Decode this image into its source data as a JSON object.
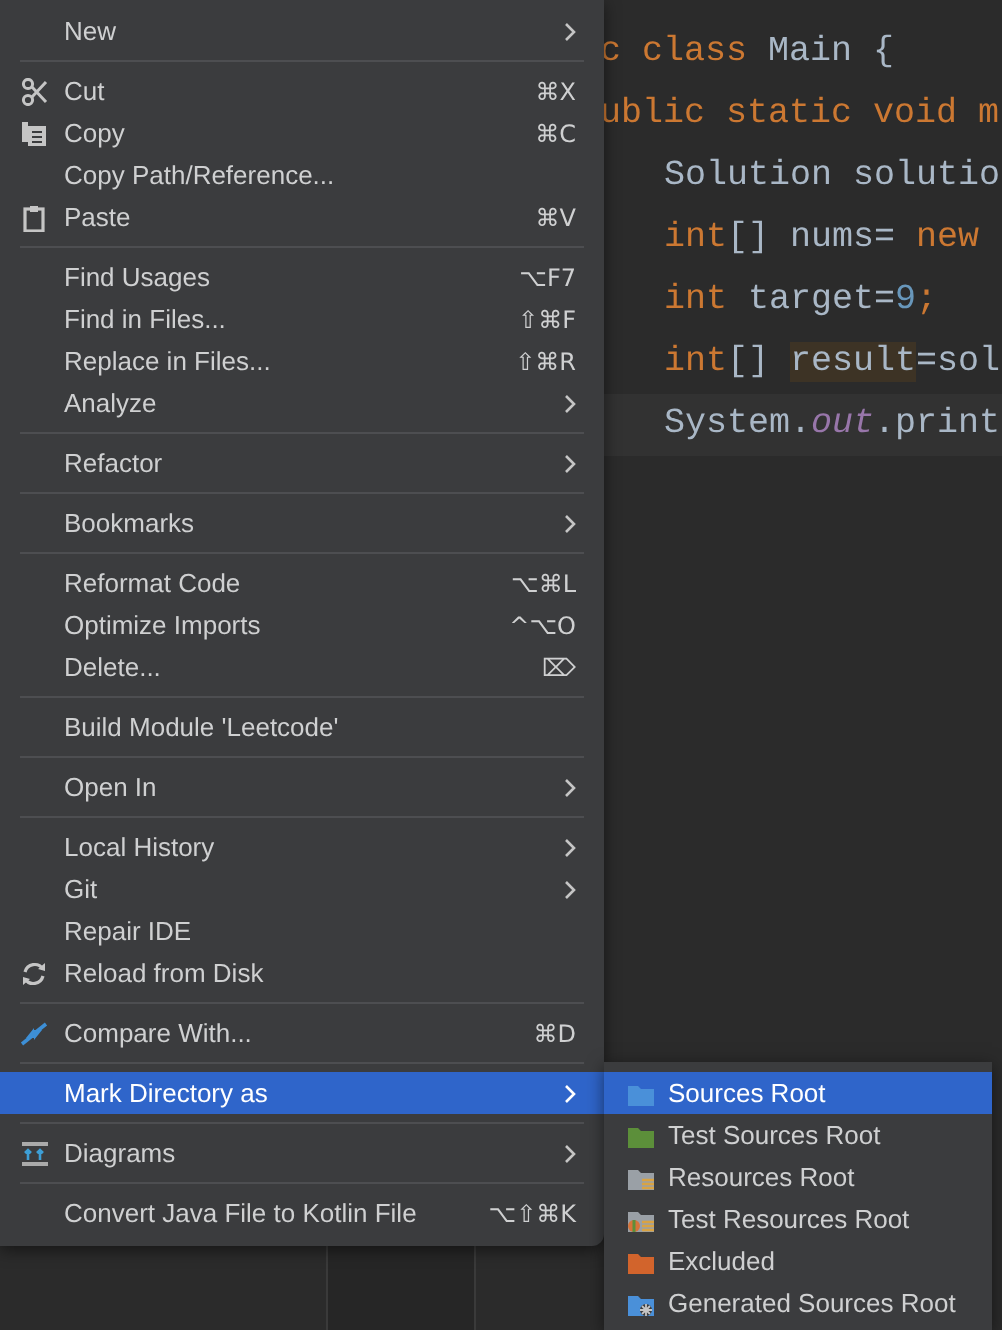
{
  "editor": {
    "lines": [
      {
        "kind": "signature",
        "tokens": [
          {
            "kind": "keyword",
            "text": "c class "
          },
          {
            "kind": "plain",
            "text": "Main {"
          }
        ]
      },
      {
        "kind": "signature",
        "tokens": [
          {
            "kind": "keyword",
            "text": "ublic static void m"
          }
        ]
      },
      {
        "kind": "body",
        "tokens": [
          {
            "kind": "plain",
            "text": "Solution solutio"
          }
        ]
      },
      {
        "kind": "body",
        "tokens": [
          {
            "kind": "keyword",
            "text": "int"
          },
          {
            "kind": "plain",
            "text": "[] nums= "
          },
          {
            "kind": "keyword",
            "text": "new"
          }
        ]
      },
      {
        "kind": "body",
        "tokens": [
          {
            "kind": "keyword",
            "text": "int "
          },
          {
            "kind": "plain",
            "text": "target="
          },
          {
            "kind": "number",
            "text": "9"
          },
          {
            "kind": "keyword",
            "text": ";"
          }
        ]
      },
      {
        "kind": "body",
        "tokens": [
          {
            "kind": "keyword",
            "text": "int"
          },
          {
            "kind": "plain",
            "text": "[] "
          },
          {
            "kind": "highlighted",
            "text": "result"
          },
          {
            "kind": "plain",
            "text": "=sol"
          }
        ]
      },
      {
        "kind": "current",
        "tokens": [
          {
            "kind": "plain",
            "text": "System."
          },
          {
            "kind": "field",
            "text": "out"
          },
          {
            "kind": "plain",
            "text": ".print"
          }
        ]
      }
    ]
  },
  "context_menu": {
    "groups": [
      [
        {
          "label": "New",
          "submenu": true,
          "selected": false
        }
      ],
      [
        {
          "label": "Cut",
          "shortcut": "⌘X",
          "kind": "scissors",
          "submenu": false,
          "selected": false
        },
        {
          "label": "Copy",
          "shortcut": "⌘C",
          "kind": "copy",
          "submenu": false,
          "selected": false
        },
        {
          "label": "Copy Path/Reference...",
          "submenu": false,
          "selected": false
        },
        {
          "label": "Paste",
          "shortcut": "⌘V",
          "kind": "paste",
          "submenu": false,
          "selected": false
        }
      ],
      [
        {
          "label": "Find Usages",
          "shortcut": "⌥F7",
          "submenu": false,
          "selected": false
        },
        {
          "label": "Find in Files...",
          "shortcut": "⇧⌘F",
          "submenu": false,
          "selected": false
        },
        {
          "label": "Replace in Files...",
          "shortcut": "⇧⌘R",
          "submenu": false,
          "selected": false
        },
        {
          "label": "Analyze",
          "submenu": true,
          "selected": false
        }
      ],
      [
        {
          "label": "Refactor",
          "submenu": true,
          "selected": false
        }
      ],
      [
        {
          "label": "Bookmarks",
          "submenu": true,
          "selected": false
        }
      ],
      [
        {
          "label": "Reformat Code",
          "shortcut": "⌥⌘L",
          "submenu": false,
          "selected": false
        },
        {
          "label": "Optimize Imports",
          "shortcut": "^⌥O",
          "submenu": false,
          "selected": false
        },
        {
          "label": "Delete...",
          "shortcut": "⌦",
          "submenu": false,
          "selected": false
        }
      ],
      [
        {
          "label": "Build Module 'Leetcode'",
          "submenu": false,
          "selected": false
        }
      ],
      [
        {
          "label": "Open In",
          "submenu": true,
          "selected": false
        }
      ],
      [
        {
          "label": "Local History",
          "submenu": true,
          "selected": false
        },
        {
          "label": "Git",
          "submenu": true,
          "selected": false
        },
        {
          "label": "Repair IDE",
          "submenu": false,
          "selected": false
        },
        {
          "label": "Reload from Disk",
          "kind": "reload",
          "submenu": false,
          "selected": false
        }
      ],
      [
        {
          "label": "Compare With...",
          "shortcut": "⌘D",
          "kind": "compare",
          "submenu": false,
          "selected": false
        }
      ],
      [
        {
          "label": "Mark Directory as",
          "submenu": true,
          "selected": true
        }
      ],
      [
        {
          "label": "Diagrams",
          "kind": "diagram",
          "submenu": true,
          "selected": false
        }
      ],
      [
        {
          "label": "Convert Java File to Kotlin File",
          "shortcut": "⌥⇧⌘K",
          "submenu": false,
          "selected": false
        }
      ]
    ]
  },
  "submenu": {
    "items": [
      {
        "label": "Sources Root",
        "kind": "sources",
        "selected": true
      },
      {
        "label": "Test Sources Root",
        "kind": "test_sources",
        "selected": false
      },
      {
        "label": "Resources Root",
        "kind": "resources",
        "selected": false
      },
      {
        "label": "Test Resources Root",
        "kind": "test_resources",
        "selected": false
      },
      {
        "label": "Excluded",
        "kind": "excluded",
        "selected": false
      },
      {
        "label": "Generated Sources Root",
        "kind": "generated",
        "selected": false
      }
    ]
  }
}
